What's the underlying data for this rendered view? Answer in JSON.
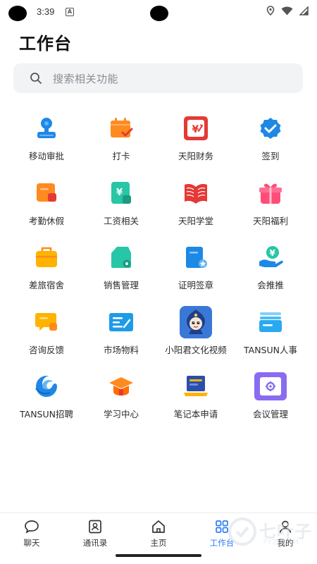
{
  "status_bar": {
    "time": "3:39",
    "notification_letter": "A"
  },
  "page": {
    "title": "工作台"
  },
  "search": {
    "placeholder": "搜索相关功能",
    "icon": "search-icon"
  },
  "apps": [
    {
      "label": "移动审批",
      "icon": "approval-stamp-icon",
      "color": "#1e88e5"
    },
    {
      "label": "打卡",
      "icon": "calendar-check-icon",
      "color": "#ff8a1f"
    },
    {
      "label": "天阳财务",
      "icon": "finance-yen-icon",
      "color": "#e53935"
    },
    {
      "label": "签到",
      "icon": "checkin-badge-icon",
      "color": "#1e88e5"
    },
    {
      "label": "考勤休假",
      "icon": "leave-card-icon",
      "color": "#ff8a1f"
    },
    {
      "label": "工资相关",
      "icon": "salary-yen-icon",
      "color": "#26c6a6"
    },
    {
      "label": "天阳学堂",
      "icon": "open-book-icon",
      "color": "#e53935"
    },
    {
      "label": "天阳福利",
      "icon": "gift-box-icon",
      "color": "#ff4d7a"
    },
    {
      "label": "差旅宿舍",
      "icon": "travel-bag-icon",
      "color": "#ffb300"
    },
    {
      "label": "销售管理",
      "icon": "sales-tag-icon",
      "color": "#26c6a6"
    },
    {
      "label": "证明签章",
      "icon": "certificate-seal-icon",
      "color": "#1e88e5"
    },
    {
      "label": "会推推",
      "icon": "hand-yen-icon",
      "color": "#1e88e5"
    },
    {
      "label": "咨询反馈",
      "icon": "chat-feedback-icon",
      "color": "#ffb300"
    },
    {
      "label": "市场物料",
      "icon": "material-card-icon",
      "color": "#1e9be8"
    },
    {
      "label": "小阳君文化视频",
      "icon": "mascot-video-icon",
      "color": "#3a78d8"
    },
    {
      "label": "TANSUN人事",
      "icon": "hr-folder-icon",
      "color": "#29a9f0"
    },
    {
      "label": "TANSUN招聘",
      "icon": "recruit-wave-icon",
      "color": "#1e88e5"
    },
    {
      "label": "学习中心",
      "icon": "graduation-cap-icon",
      "color": "#ff8a1f"
    },
    {
      "label": "笔记本申请",
      "icon": "laptop-apply-icon",
      "color": "#2b4fa8"
    },
    {
      "label": "会议管理",
      "icon": "meeting-safe-icon",
      "color": "#8a6cf0"
    }
  ],
  "tabbar": {
    "items": [
      {
        "label": "聊天",
        "icon": "chat-bubble-icon"
      },
      {
        "label": "通讯录",
        "icon": "contacts-icon"
      },
      {
        "label": "主页",
        "icon": "home-icon"
      },
      {
        "label": "工作台",
        "icon": "grid-icon",
        "active": true
      },
      {
        "label": "我的",
        "icon": "profile-icon"
      }
    ],
    "active_color": "#2a7cf6"
  },
  "watermark": {
    "text": "七叶子",
    "sub": "7YZ.COM"
  }
}
